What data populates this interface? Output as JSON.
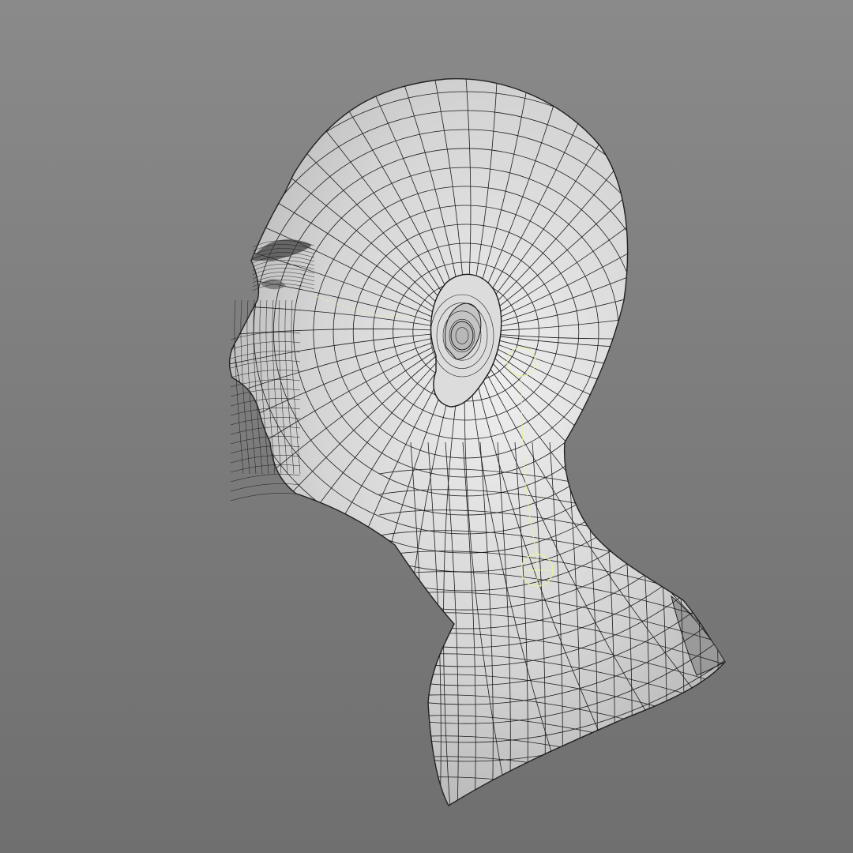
{
  "viewport": {
    "background_top": "#8a8a8a",
    "background_bottom": "#6f6f6f",
    "mesh_fill": "#d6d6d6",
    "mesh_highlight": "#ececec",
    "wire_color": "#1c1c1c",
    "joint_color": "#e9f0a0"
  },
  "model": {
    "subject": "head-and-neck-mesh",
    "display_mode": "wireframe-on-shaded",
    "view": "left-side"
  },
  "rig": {
    "joints": [
      "jaw-joint",
      "neck-joint",
      "skull-joint"
    ]
  }
}
